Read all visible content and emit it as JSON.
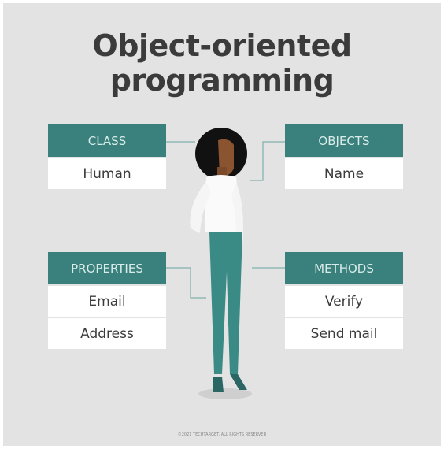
{
  "title": {
    "line1": "Object-oriented",
    "line2": "programming"
  },
  "boxes": {
    "class": {
      "header": "CLASS",
      "items": [
        "Human"
      ]
    },
    "objects": {
      "header": "OBJECTS",
      "items": [
        "Name"
      ]
    },
    "properties": {
      "header": "PROPERTIES",
      "items": [
        "Email",
        "Address"
      ]
    },
    "methods": {
      "header": "METHODS",
      "items": [
        "Verify",
        "Send mail"
      ]
    }
  },
  "copyright": "©2021 TECHTARGET. ALL RIGHTS RESERVED",
  "colors": {
    "accent": "#3a807c",
    "background": "#e3e3e3",
    "text": "#3b3b3b"
  }
}
